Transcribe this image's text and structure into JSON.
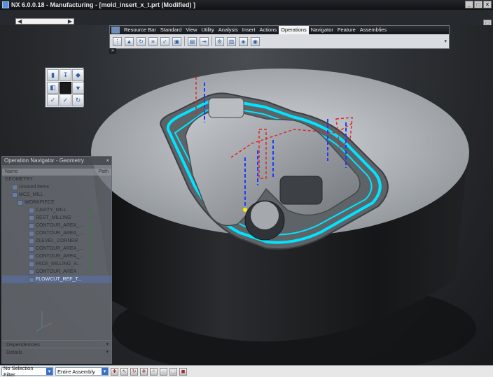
{
  "window": {
    "title": "NX 6.0.0.18 - Manufacturing - [mold_insert_x_t.prt (Modified) ]",
    "controls": [
      "minimize-icon",
      "maximize-icon",
      "close-icon"
    ]
  },
  "doc_tabs": {
    "scroll_left": "◀",
    "scroll_right": "▶"
  },
  "menubar": {
    "tabs": [
      {
        "label": "Resource Bar",
        "active": false
      },
      {
        "label": "Standard",
        "active": false
      },
      {
        "label": "View",
        "active": false
      },
      {
        "label": "Utility",
        "active": false
      },
      {
        "label": "Analysis",
        "active": false
      },
      {
        "label": "Insert",
        "active": false
      },
      {
        "label": "Actions",
        "active": false
      },
      {
        "label": "Operations",
        "active": true
      },
      {
        "label": "Navigator",
        "active": false
      },
      {
        "label": "Feature",
        "active": false
      },
      {
        "label": "Assemblies",
        "active": false
      }
    ],
    "overflow": "»",
    "dropdown": "▾",
    "tool_icons": [
      "generate-path-icon",
      "replay-icon",
      "list-path-icon",
      "verify-icon",
      "post-process-icon",
      "shop-doc-icon",
      "output-cls-icon",
      "machine-control-icon",
      "feed-rate-icon",
      "gouge-check-icon",
      "collision-icon",
      "analyze-icon"
    ]
  },
  "palette": {
    "icons": [
      "create-program-icon",
      "create-tool-icon",
      "create-geometry-icon",
      "create-method-icon",
      "blank-icon",
      "create-operation-icon",
      "display-tool-icon",
      "verify-path-icon",
      "generate-icon"
    ]
  },
  "operation_navigator": {
    "title": "Operation Navigator - Geometry",
    "col_name": "Name",
    "col_path": "Path",
    "rows": [
      {
        "label": "GEOMETRY",
        "indent": 0,
        "check": ""
      },
      {
        "label": "Unused Items",
        "indent": 1,
        "check": ""
      },
      {
        "label": "MCS_MILL",
        "indent": 1,
        "check": ""
      },
      {
        "label": "WORKPIECE",
        "indent": 2,
        "check": ""
      },
      {
        "label": "CAVITY_MILL",
        "indent": 3,
        "check": "✔"
      },
      {
        "label": "REST_MILLING",
        "indent": 3,
        "check": "✔"
      },
      {
        "label": "CONTOUR_AREA_...",
        "indent": 3,
        "check": "✔"
      },
      {
        "label": "CONTOUR_AREA_...",
        "indent": 3,
        "check": "✔"
      },
      {
        "label": "ZLEVEL_CORNER",
        "indent": 3,
        "check": "✔"
      },
      {
        "label": "CONTOUR_AREA_...",
        "indent": 3,
        "check": "✔"
      },
      {
        "label": "CONTOUR_AREA_...",
        "indent": 3,
        "check": "✔"
      },
      {
        "label": "FACE_MILLING_A...",
        "indent": 3,
        "check": "✔"
      },
      {
        "label": "CONTOUR_AREA",
        "indent": 3,
        "check": "✔"
      },
      {
        "label": "FLOWCUT_REF_T...",
        "indent": 3,
        "check": "",
        "selected": true
      }
    ],
    "dependencies": "Dependencies",
    "details": "Details",
    "footer_arrow": "▾"
  },
  "status": {
    "selection_filter": "No Selection Filter",
    "assembly_scope": "Entire Assembly",
    "icons": [
      "snap-point-icon",
      "select-icon",
      "rotate-icon",
      "pan-icon",
      "zoom-icon",
      "lasso-icon",
      "fit-icon",
      "lock-icon"
    ]
  },
  "colors": {
    "toolpath": "#00e5ff",
    "engage_lines": "#1c3cff",
    "rapid_lines": "#e02020",
    "part_surface": "#a8adb3"
  }
}
